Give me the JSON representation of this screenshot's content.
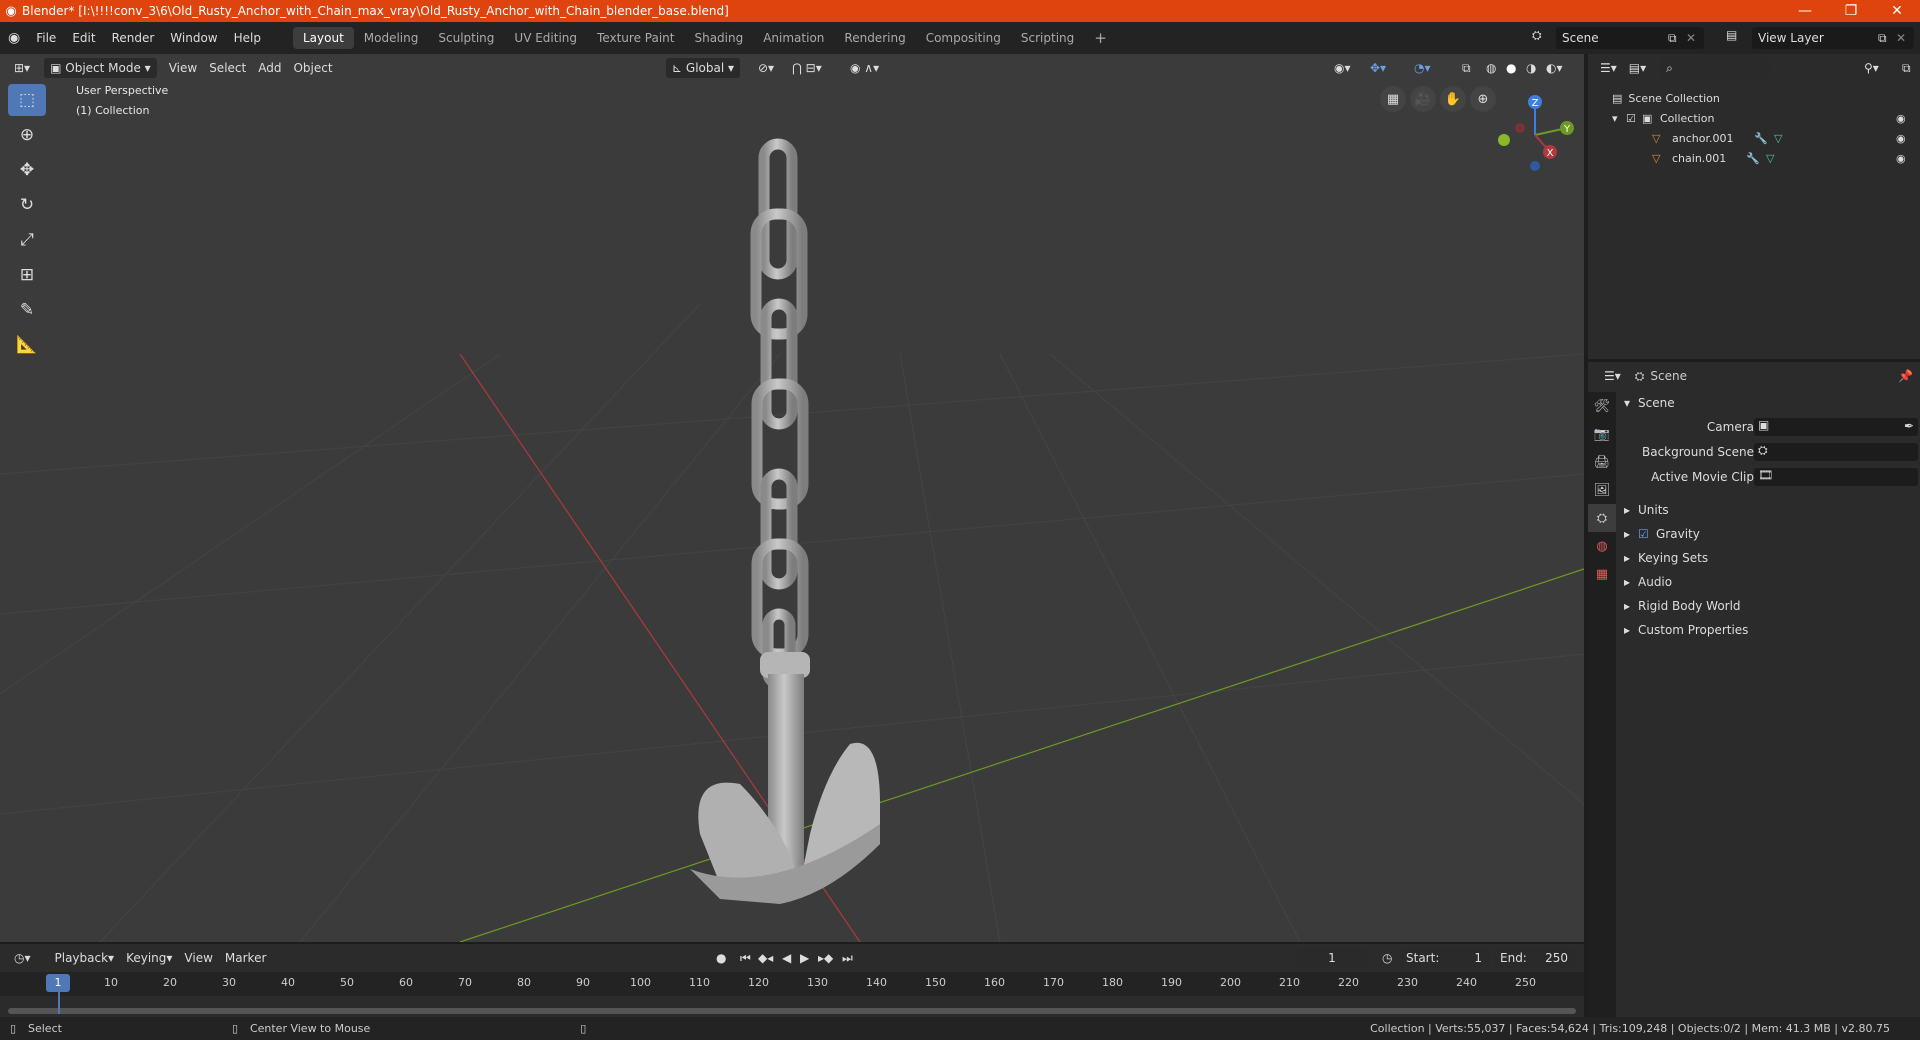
{
  "window": {
    "title": "Blender* [I:\\!!!!conv_3\\6\\Old_Rusty_Anchor_with_Chain_max_vray\\Old_Rusty_Anchor_with_Chain_blender_base.blend]",
    "minimize": "—",
    "maximize": "❐",
    "close": "✕"
  },
  "menu": [
    "File",
    "Edit",
    "Render",
    "Window",
    "Help"
  ],
  "workspaces": [
    "Layout",
    "Modeling",
    "Sculpting",
    "UV Editing",
    "Texture Paint",
    "Shading",
    "Animation",
    "Rendering",
    "Compositing",
    "Scripting"
  ],
  "scene_selector": {
    "value": "Scene"
  },
  "view_layer_selector": {
    "value": "View Layer"
  },
  "viewport": {
    "mode": "Object Mode",
    "menus": [
      "View",
      "Select",
      "Add",
      "Object"
    ],
    "transform_orientation": "Global",
    "overlay_title": "User Perspective",
    "overlay_collection": "(1) Collection",
    "gizmo_axes": {
      "x": "X",
      "y": "Y",
      "z": "Z"
    },
    "colors": {
      "x_axis": "#b0383f",
      "y_axis": "#6d9a23",
      "z_axis": "#3c7fe0",
      "active_tool": "#5077b6"
    }
  },
  "outliner": {
    "root": "Scene Collection",
    "collection": "Collection",
    "objects": [
      "anchor.001",
      "chain.001"
    ]
  },
  "properties": {
    "context": "Scene",
    "panel_title": "Scene",
    "fields": {
      "camera": "Camera",
      "background_scene": "Background Scene",
      "active_movie_clip": "Active Movie Clip"
    },
    "sections": [
      "Units",
      "Gravity",
      "Keying Sets",
      "Audio",
      "Rigid Body World",
      "Custom Properties"
    ],
    "gravity_enabled": true
  },
  "timeline": {
    "menus": [
      "Playback",
      "Keying",
      "View",
      "Marker"
    ],
    "current_frame": "1",
    "start_label": "Start:",
    "start": "1",
    "end_label": "End:",
    "end": "250",
    "ruler": [
      "1",
      "10",
      "20",
      "30",
      "40",
      "50",
      "60",
      "70",
      "80",
      "90",
      "100",
      "110",
      "120",
      "130",
      "140",
      "150",
      "160",
      "170",
      "180",
      "190",
      "200",
      "210",
      "220",
      "230",
      "240",
      "250"
    ]
  },
  "statusbar": {
    "select": "Select",
    "center_view": "Center View to Mouse",
    "stats": "Collection | Verts:55,037 | Faces:54,624 | Tris:109,248 | Objects:0/2 | Mem: 41.3 MB | v2.80.75"
  }
}
